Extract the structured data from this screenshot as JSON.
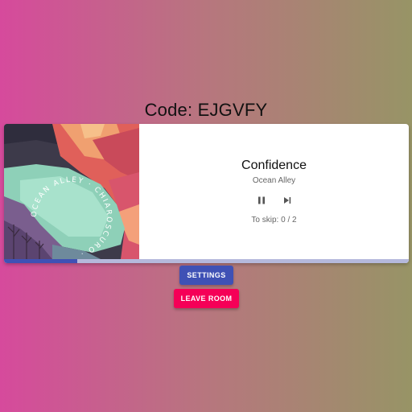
{
  "room": {
    "code_label": "Code: EJGVFY"
  },
  "player": {
    "title": "Confidence",
    "artist": "Ocean Alley",
    "skip_text": "To skip: 0 / 2",
    "progress_fraction": 0.18,
    "album_art": {
      "ring_text": "OCEAN ALLEY · CHIAROSCURO ·"
    },
    "controls": {
      "pause_icon": "pause-icon",
      "next_icon": "skip-next-icon"
    }
  },
  "buttons": {
    "settings_label": "SETTINGS",
    "leave_label": "LEAVE ROOM"
  },
  "colors": {
    "primary": "#3f51b5",
    "secondary": "#f50057",
    "progress_track": "#b5b9dc"
  }
}
